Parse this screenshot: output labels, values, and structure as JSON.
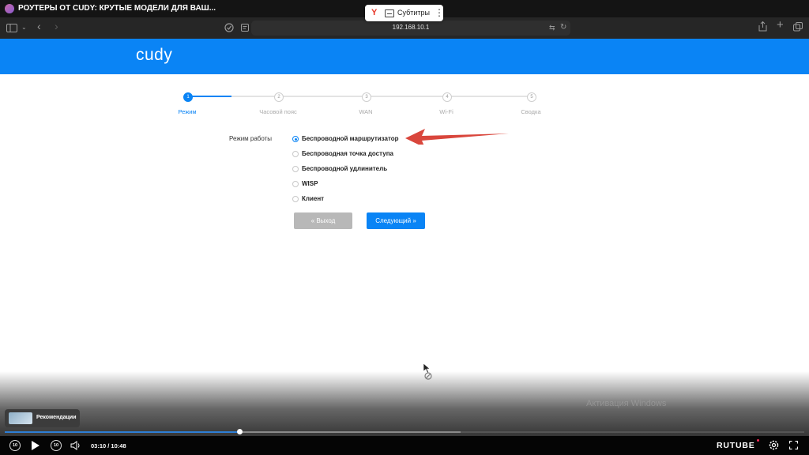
{
  "video": {
    "title": "РОУТЕРЫ ОТ CUDY: КРУТЫЕ МОДЕЛИ ДЛЯ ВАШ..."
  },
  "subtitles_button": {
    "label": "Субтитры",
    "brand_icon": "yandex-y-icon"
  },
  "browser": {
    "url": "192.168.10.1",
    "icons": [
      "sidebar-icon",
      "back-icon",
      "forward-icon",
      "shield-icon",
      "reader-icon",
      "translate-icon",
      "reload-icon",
      "share-icon",
      "new-tab-icon",
      "tabs-icon"
    ]
  },
  "router_page": {
    "logo": "cudy",
    "accent_color": "#0a84f5",
    "steps": [
      {
        "number": "1",
        "label": "Режим",
        "active": true
      },
      {
        "number": "2",
        "label": "Часовой пояс",
        "active": false
      },
      {
        "number": "3",
        "label": "WAN",
        "active": false
      },
      {
        "number": "4",
        "label": "Wi-Fi",
        "active": false
      },
      {
        "number": "5",
        "label": "Сводка",
        "active": false
      }
    ],
    "form": {
      "mode_label": "Режим работы",
      "options": [
        {
          "label": "Беспроводной маршрутизатор",
          "checked": true
        },
        {
          "label": "Беспроводная точка доступа",
          "checked": false
        },
        {
          "label": "Беспроводной удлинитель",
          "checked": false
        },
        {
          "label": "WISP",
          "checked": false
        },
        {
          "label": "Клиент",
          "checked": false
        }
      ],
      "back_label": "« Выход",
      "next_label": "Следующий »"
    }
  },
  "overlay": {
    "watermark": "Активация Windows",
    "arrow_color": "#d9463c"
  },
  "player": {
    "recommendations_label": "Рекомендации",
    "time": "03:10 / 10:48",
    "progress_fraction": 0.293,
    "buffer_fraction": 0.57,
    "skip_back_label": "10",
    "skip_forward_label": "10",
    "brand": "RUTUBE",
    "progress_color": "#2e7fd6"
  }
}
